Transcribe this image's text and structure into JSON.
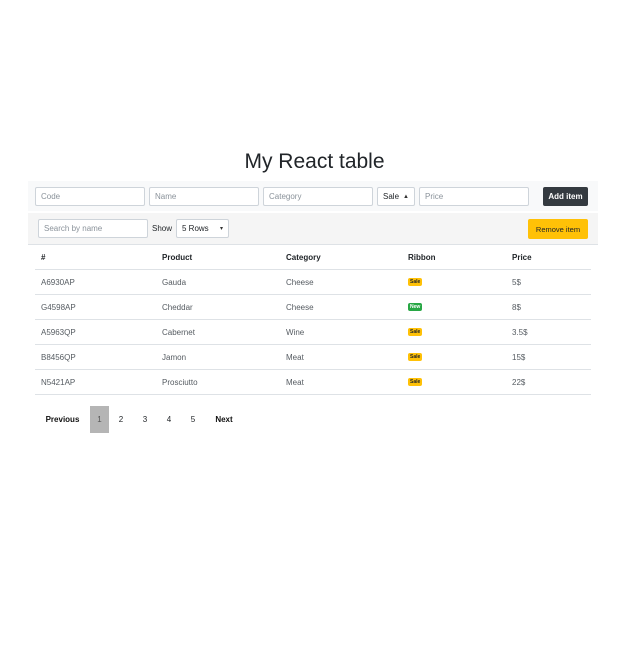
{
  "title": "My React table",
  "add_form": {
    "code_placeholder": "Code",
    "name_placeholder": "Name",
    "category_placeholder": "Category",
    "ribbon_select": "Sale",
    "price_placeholder": "Price",
    "add_button": "Add item"
  },
  "filter": {
    "search_placeholder": "Search by name",
    "show_label": "Show",
    "rows_select": "5 Rows",
    "remove_button": "Remove item"
  },
  "table": {
    "headers": [
      "#",
      "Product",
      "Category",
      "Ribbon",
      "Price"
    ],
    "rows": [
      {
        "code": "A6930AP",
        "product": "Gauda",
        "category": "Cheese",
        "ribbon": "Sale",
        "price": "5$"
      },
      {
        "code": "G4598AP",
        "product": "Cheddar",
        "category": "Cheese",
        "ribbon": "New",
        "price": "8$"
      },
      {
        "code": "A5963QP",
        "product": "Cabernet",
        "category": "Wine",
        "ribbon": "Sale",
        "price": "3.5$"
      },
      {
        "code": "B8456QP",
        "product": "Jamon",
        "category": "Meat",
        "ribbon": "Sale",
        "price": "15$"
      },
      {
        "code": "N5421AP",
        "product": "Prosciutto",
        "category": "Meat",
        "ribbon": "Sale",
        "price": "22$"
      }
    ]
  },
  "pagination": {
    "previous": "Previous",
    "pages": [
      "1",
      "2",
      "3",
      "4",
      "5"
    ],
    "current": "1",
    "next": "Next"
  },
  "colors": {
    "sale_badge": "#ffc107",
    "new_badge": "#28a745",
    "add_button": "#343a40",
    "remove_button": "#ffc107",
    "active_page": "#b5b5b5"
  }
}
